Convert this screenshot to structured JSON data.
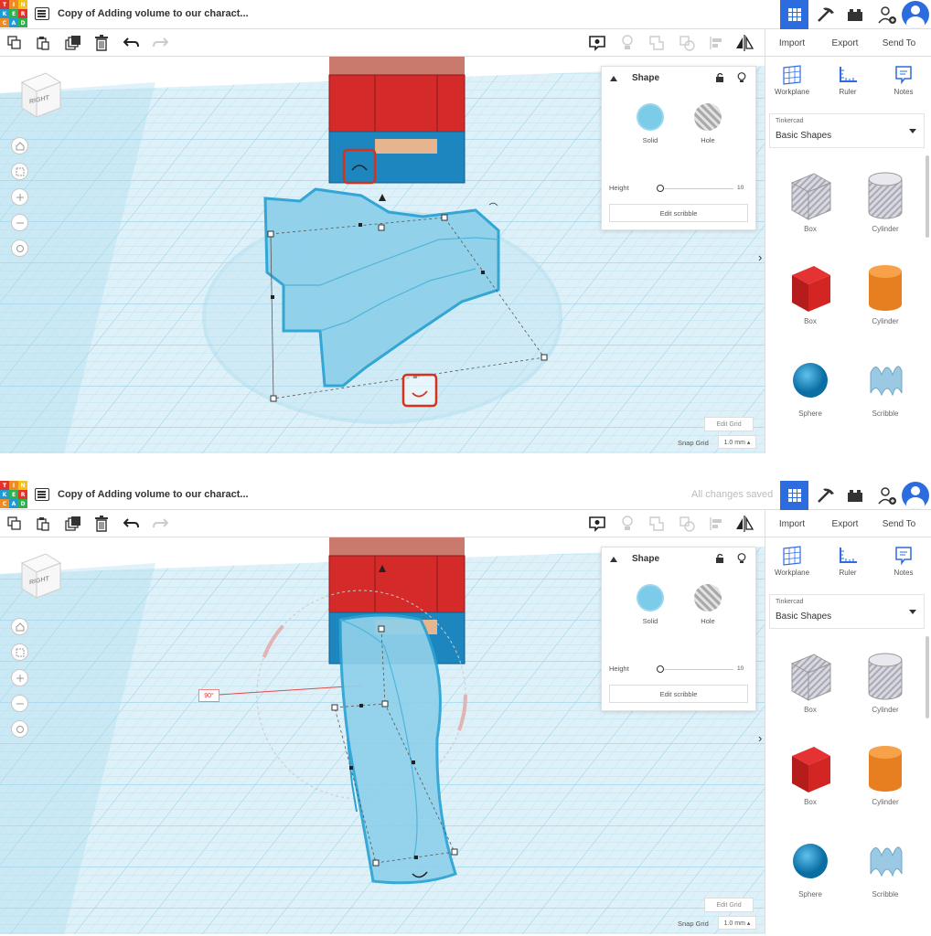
{
  "frames": [
    {
      "logo_letters": [
        "TIN",
        "KER",
        "CAD"
      ],
      "project_title": "Copy of Adding volume to our charact...",
      "saved_status": "",
      "actions": {
        "import": "Import",
        "export": "Export",
        "send_to": "Send To"
      },
      "panel": {
        "title": "Shape",
        "solid": "Solid",
        "hole": "Hole",
        "height_label": "Height",
        "height_value": "10",
        "edit_scribble": "Edit scribble"
      },
      "sidebar": {
        "workplane": "Workplane",
        "ruler": "Ruler",
        "notes": "Notes",
        "library_label": "Tinkercad",
        "library_value": "Basic Shapes"
      },
      "shapes": [
        "Box",
        "Cylinder",
        "Box",
        "Cylinder",
        "Sphere",
        "Scribble"
      ],
      "viewcube": "RIGHT",
      "edit_grid": "Edit Grid",
      "snap_grid_label": "Snap Grid",
      "snap_grid_value": "1.0 mm ▴",
      "angle_label": ""
    },
    {
      "logo_letters": [
        "TIN",
        "KER",
        "CAD"
      ],
      "project_title": "Copy of Adding volume to our charact...",
      "saved_status": "All changes saved",
      "actions": {
        "import": "Import",
        "export": "Export",
        "send_to": "Send To"
      },
      "panel": {
        "title": "Shape",
        "solid": "Solid",
        "hole": "Hole",
        "height_label": "Height",
        "height_value": "10",
        "edit_scribble": "Edit scribble"
      },
      "sidebar": {
        "workplane": "Workplane",
        "ruler": "Ruler",
        "notes": "Notes",
        "library_label": "Tinkercad",
        "library_value": "Basic Shapes"
      },
      "shapes": [
        "Box",
        "Cylinder",
        "Box",
        "Cylinder",
        "Sphere",
        "Scribble"
      ],
      "viewcube": "RIGHT",
      "edit_grid": "Edit Grid",
      "snap_grid_label": "Snap Grid",
      "snap_grid_value": "1.0 mm ▴",
      "angle_label": "90°"
    }
  ],
  "colors": {
    "accent": "#2d6cdf",
    "grid": "#c8e6f2",
    "shape": "#8fd0ea",
    "selection": "#2aa3d4",
    "highlight_box": "#d9301a",
    "character_red": "#d42a2a",
    "character_blue": "#1e86bf"
  }
}
